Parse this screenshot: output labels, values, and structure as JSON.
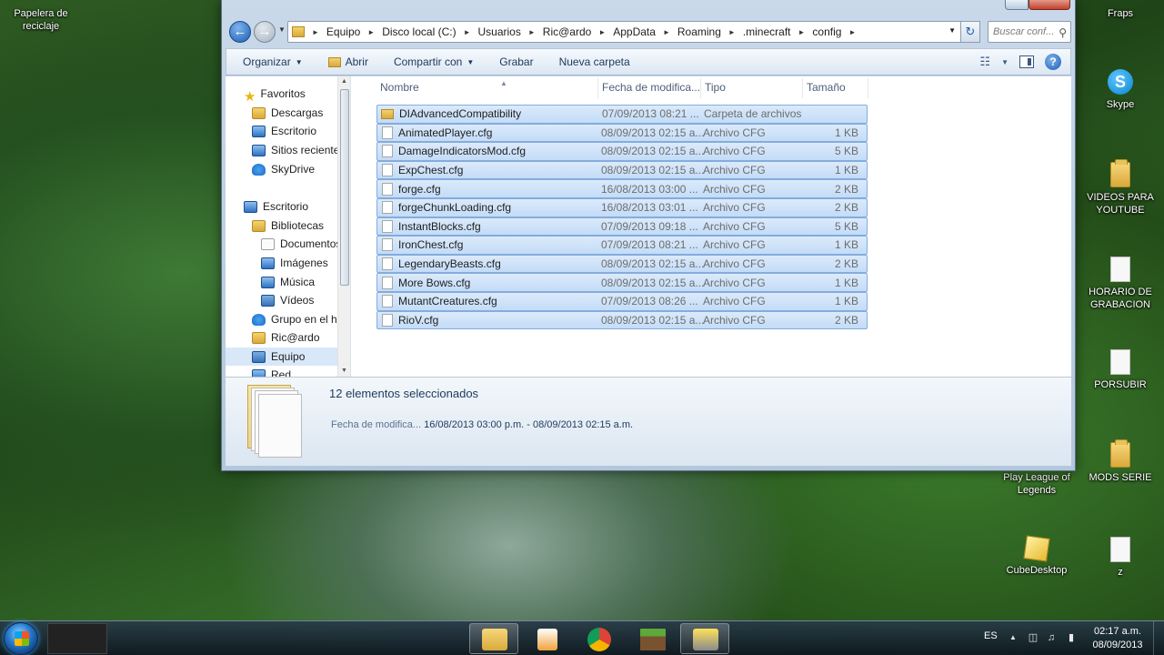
{
  "desktop": {
    "icons": [
      {
        "label": "Papelera de reciclaje"
      },
      {
        "label": "Fraps"
      },
      {
        "label": "Skype"
      },
      {
        "label": "VIDEOS PARA YOUTUBE"
      },
      {
        "label": "HORARIO DE GRABACION"
      },
      {
        "label": "PORSUBIR"
      },
      {
        "label": "Play League of Legends"
      },
      {
        "label": "MODS SERIE"
      },
      {
        "label": "CubeDesktop"
      },
      {
        "label": "z"
      }
    ]
  },
  "window": {
    "breadcrumb": [
      "Equipo",
      "Disco local (C:)",
      "Usuarios",
      "Ric@ardo",
      "AppData",
      "Roaming",
      ".minecraft",
      "config"
    ],
    "search_placeholder": "Buscar conf...",
    "toolbar": {
      "organizar": "Organizar",
      "abrir": "Abrir",
      "compartir": "Compartir con",
      "grabar": "Grabar",
      "nueva_carpeta": "Nueva carpeta"
    },
    "nav_pane": [
      {
        "label": "Favoritos",
        "icon": "star-icon"
      },
      {
        "label": "Descargas",
        "icon": "downloads-folder-icon"
      },
      {
        "label": "Escritorio",
        "icon": "desktop-icon"
      },
      {
        "label": "Sitios recientes",
        "icon": "recent-places-icon"
      },
      {
        "label": "SkyDrive",
        "icon": "skydrive-icon"
      },
      {
        "label": "Escritorio",
        "icon": "desktop-icon"
      },
      {
        "label": "Bibliotecas",
        "icon": "libraries-icon"
      },
      {
        "label": "Documentos",
        "icon": "documents-icon"
      },
      {
        "label": "Imágenes",
        "icon": "pictures-icon"
      },
      {
        "label": "Música",
        "icon": "music-icon"
      },
      {
        "label": "Vídeos",
        "icon": "videos-icon"
      },
      {
        "label": "Grupo en el hoga",
        "icon": "homegroup-icon"
      },
      {
        "label": "Ric@ardo",
        "icon": "user-folder-icon"
      },
      {
        "label": "Equipo",
        "icon": "computer-icon"
      },
      {
        "label": "Red",
        "icon": "network-icon"
      }
    ],
    "columns": {
      "name": "Nombre",
      "date": "Fecha de modifica...",
      "type": "Tipo",
      "size": "Tamaño"
    },
    "files": [
      {
        "name": "DIAdvancedCompatibility",
        "date": "07/09/2013 08:21 ...",
        "type": "Carpeta de archivos",
        "size": ""
      },
      {
        "name": "AnimatedPlayer.cfg",
        "date": "08/09/2013 02:15 a...",
        "type": "Archivo CFG",
        "size": "1 KB"
      },
      {
        "name": "DamageIndicatorsMod.cfg",
        "date": "08/09/2013 02:15 a...",
        "type": "Archivo CFG",
        "size": "5 KB"
      },
      {
        "name": "ExpChest.cfg",
        "date": "08/09/2013 02:15 a...",
        "type": "Archivo CFG",
        "size": "1 KB"
      },
      {
        "name": "forge.cfg",
        "date": "16/08/2013 03:00 ...",
        "type": "Archivo CFG",
        "size": "2 KB"
      },
      {
        "name": "forgeChunkLoading.cfg",
        "date": "16/08/2013 03:01 ...",
        "type": "Archivo CFG",
        "size": "2 KB"
      },
      {
        "name": "InstantBlocks.cfg",
        "date": "07/09/2013 09:18 ...",
        "type": "Archivo CFG",
        "size": "5 KB"
      },
      {
        "name": "IronChest.cfg",
        "date": "07/09/2013 08:21 ...",
        "type": "Archivo CFG",
        "size": "1 KB"
      },
      {
        "name": "LegendaryBeasts.cfg",
        "date": "08/09/2013 02:15 a...",
        "type": "Archivo CFG",
        "size": "2 KB"
      },
      {
        "name": "More Bows.cfg",
        "date": "08/09/2013 02:15 a...",
        "type": "Archivo CFG",
        "size": "1 KB"
      },
      {
        "name": "MutantCreatures.cfg",
        "date": "07/09/2013 08:26 ...",
        "type": "Archivo CFG",
        "size": "1 KB"
      },
      {
        "name": "RioV.cfg",
        "date": "08/09/2013 02:15 a...",
        "type": "Archivo CFG",
        "size": "2 KB"
      }
    ],
    "details": {
      "selected_count": "12 elementos seleccionados",
      "date_label": "Fecha de modifica...",
      "date_range": "16/08/2013 03:00 p.m. - 08/09/2013 02:15 a.m."
    }
  },
  "taskbar": {
    "language": "ES",
    "time": "02:17 a.m.",
    "date": "08/09/2013"
  }
}
